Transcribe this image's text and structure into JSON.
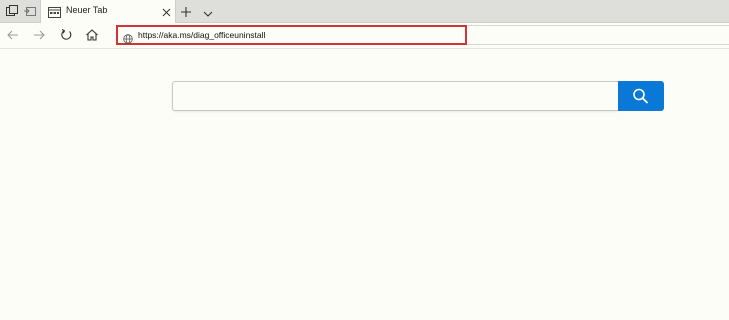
{
  "tab": {
    "title": "Neuer Tab"
  },
  "address_bar": {
    "url": "https://aka.ms/diag_officeuninstall"
  },
  "search": {
    "value": "",
    "placeholder": ""
  },
  "icons": {
    "tab_manager": "tab-manager-icon",
    "set_aside_tabs": "set-aside-tabs-icon",
    "tab_favicon": "newtab-page-icon",
    "close": "close-icon",
    "new_tab": "plus-icon",
    "tab_list": "chevron-down-icon",
    "back": "back-arrow-icon",
    "forward": "forward-arrow-icon",
    "refresh": "refresh-icon",
    "home": "home-icon",
    "site_info": "globe-icon",
    "search": "search-icon"
  },
  "colors": {
    "highlight": "#d13438",
    "search_button": "#0a78d7",
    "page_background": "#fdfdf8"
  }
}
